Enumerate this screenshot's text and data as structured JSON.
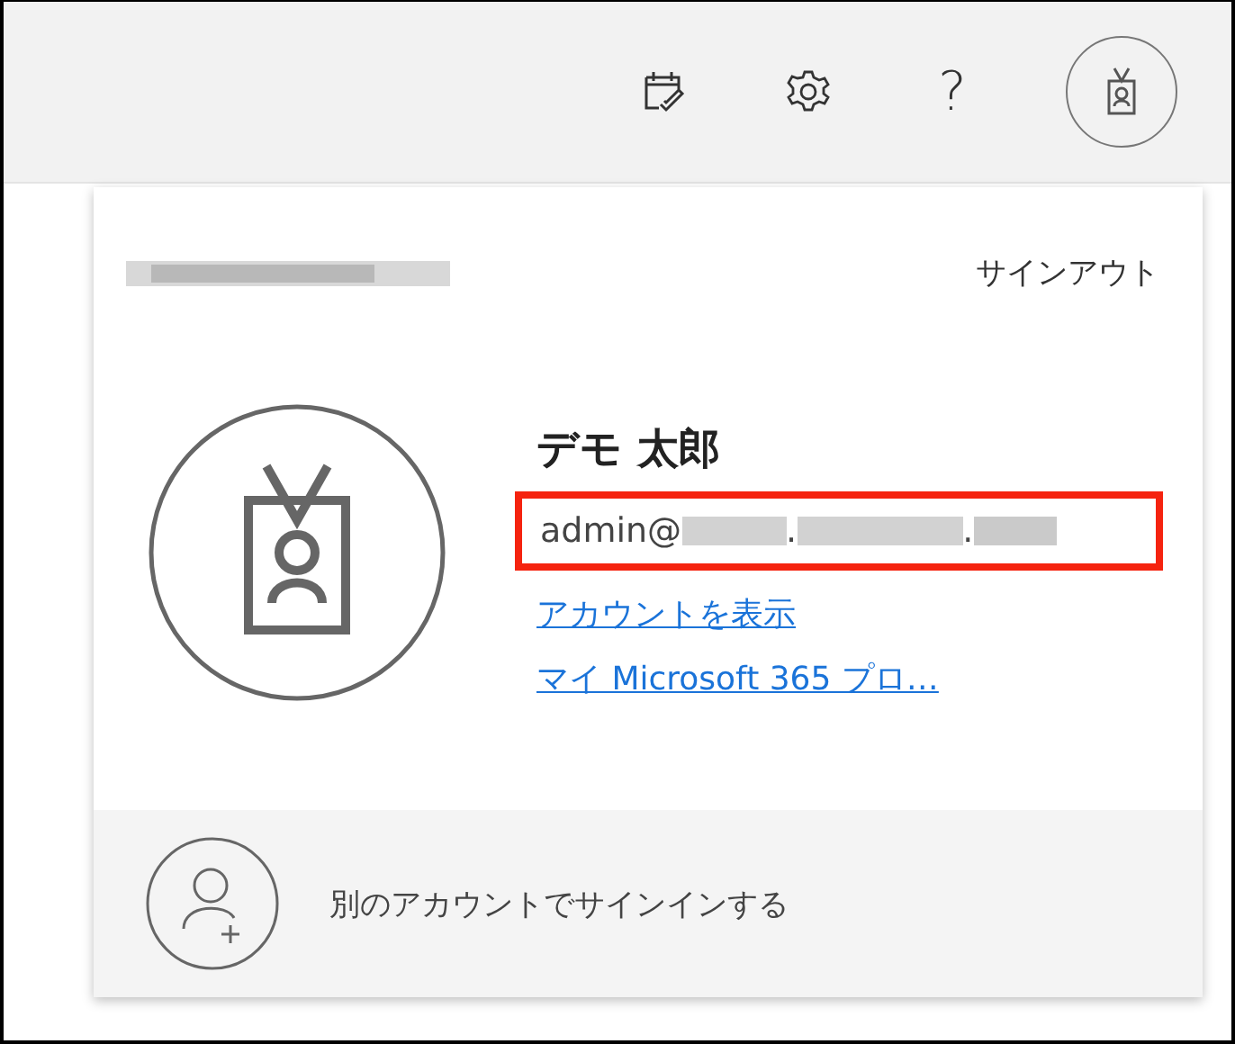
{
  "toolbar": {
    "buttons": [
      {
        "kind": "calendar"
      },
      {
        "kind": "settings"
      },
      {
        "kind": "help",
        "label": "?"
      },
      {
        "kind": "avatar"
      }
    ]
  },
  "account_panel": {
    "organization": {
      "redacted": true
    },
    "sign_out": "サインアウト",
    "name": "デモ 太郎",
    "email": {
      "visible": "admin@",
      "separators": [
        ".",
        "."
      ],
      "highlighted": true
    },
    "links": [
      "アカウントを表示",
      "マイ Microsoft 365 プロ…"
    ],
    "other_account": "別のアカウントでサインインする"
  }
}
